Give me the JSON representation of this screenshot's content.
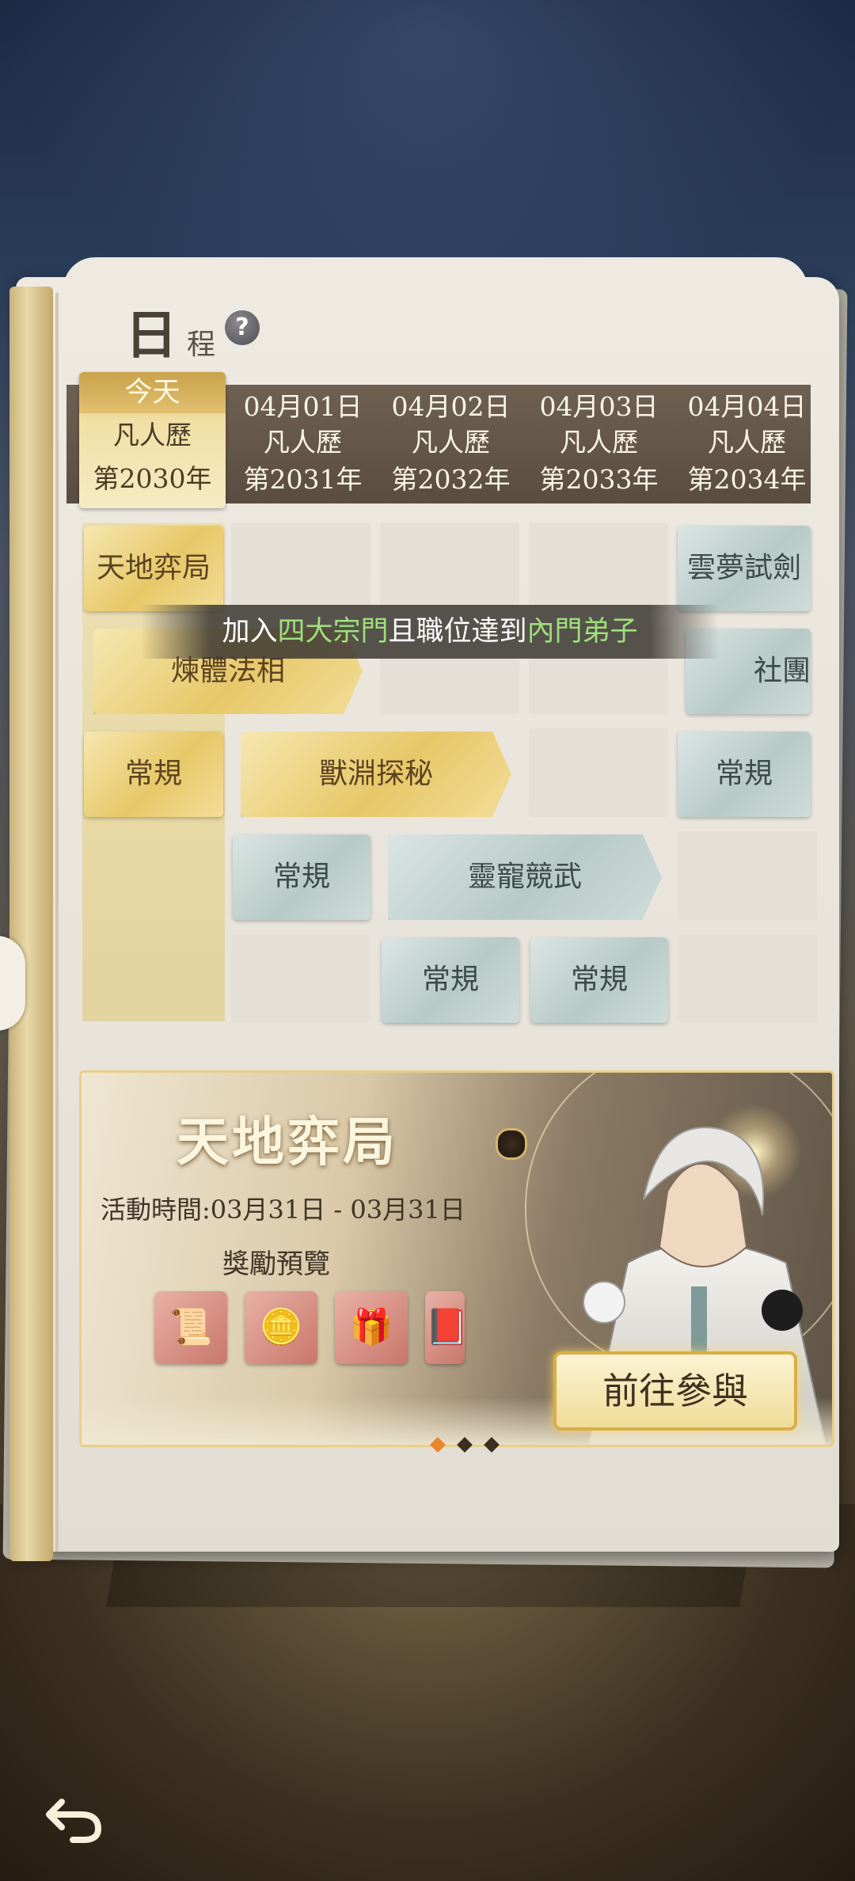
{
  "header": {
    "title_big": "日",
    "title_small": "程",
    "help": "?"
  },
  "days": [
    {
      "date": "今天",
      "cal": "凡人歷",
      "year": "第2030年"
    },
    {
      "date": "04月01日",
      "cal": "凡人歷",
      "year": "第2031年"
    },
    {
      "date": "04月02日",
      "cal": "凡人歷",
      "year": "第2032年"
    },
    {
      "date": "04月03日",
      "cal": "凡人歷",
      "year": "第2033年"
    },
    {
      "date": "04月04日",
      "cal": "凡人歷",
      "year": "第2034年"
    }
  ],
  "events": {
    "tiandi": "天地弈局",
    "yunmeng": "雲夢試劍",
    "lianti": "煉體法相",
    "shetuan": "社團",
    "changgui": "常規",
    "shouyuan": "獸淵探秘",
    "linglong": "靈寵競武"
  },
  "tooltip": {
    "p1": "加入",
    "h1": "四大宗門",
    "p2": "且職位達到",
    "h2": "內門弟子"
  },
  "banner": {
    "title": "天地弈局",
    "time": "活動時間:03月31日 - 03月31日",
    "reward_label": "獎勵預覽",
    "cta": "前往參與",
    "pages": 3,
    "active_page": 1
  },
  "colors": {
    "accent_gold": "#e7c868",
    "teal": "#b7cac7",
    "header_brown": "#5a4d40",
    "tooltip_green": "#9fe07a",
    "pager_active": "#e8862a"
  }
}
